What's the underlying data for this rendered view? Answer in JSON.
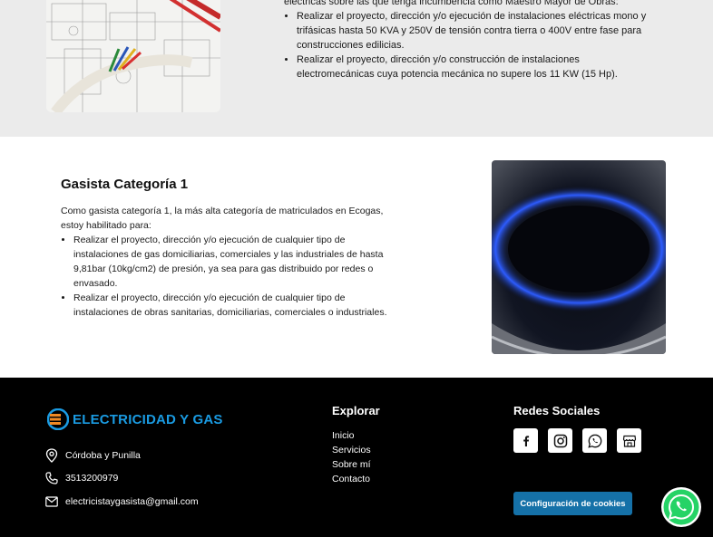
{
  "top": {
    "lead": "eléctricas sobre las que tenga incumbencia como Maestro Mayor de Obras:",
    "bullets": [
      "Realizar el proyecto, dirección y/o ejecución de instalaciones eléctricas mono y trifásicas hasta 50 KVA y 250V de tensión contra tierra o 400V entre fase para construcciones edilicias.",
      "Realizar el proyecto, dirección y/o construcción de instalaciones electromecánicas cuya potencia mecánica no supere los 11 KW (15 Hp)."
    ]
  },
  "gas": {
    "title": "Gasista Categoría 1",
    "intro": "Como gasista categoría 1, la más alta categoría de matriculados en Ecogas, estoy habilitado para:",
    "bullets": [
      "Realizar el proyecto, dirección y/o ejecución de cualquier tipo de instalaciones de gas domiciliarias, comerciales y las industriales de hasta 9,81bar (10kg/cm2) de presión, ya sea para gas distribuido por redes o envasado.",
      "Realizar el proyecto, dirección y/o ejecución de cualquier tipo de instalaciones de obras sanitarias, domiciliarias, comerciales o industriales."
    ]
  },
  "footer": {
    "logo_text": "ELECTRICIDAD Y GAS",
    "location": "Córdoba y Punilla",
    "phone": "3513200979",
    "email": "electricistaygasista@gmail.com",
    "explore_title": "Explorar",
    "nav": [
      "Inicio",
      "Servicios",
      "Sobre mí",
      "Contacto"
    ],
    "social_title": "Redes Sociales",
    "social_icons": [
      "facebook-icon",
      "instagram-icon",
      "whatsapp-icon",
      "store-icon"
    ],
    "cookie_label": "Configuración de cookies"
  },
  "colors": {
    "brand_blue": "#1a9be2",
    "brand_orange": "#f08a24",
    "cookie_button": "#1571a8",
    "section_grey": "#ebebeb",
    "whatsapp_green": "#25d366"
  }
}
